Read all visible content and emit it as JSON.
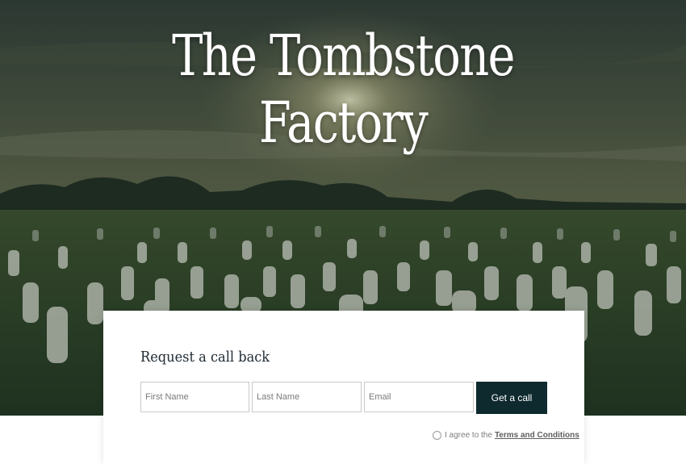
{
  "hero": {
    "title_line1": "The Tombstone",
    "title_line2": "Factory"
  },
  "callback": {
    "heading": "Request a call back",
    "first_name_placeholder": "First Name",
    "last_name_placeholder": "Last Name",
    "email_placeholder": "Email",
    "submit_label": "Get a call",
    "agree_text": "I agree to the",
    "terms_link": "Terms and Conditions"
  },
  "colors": {
    "button": "#0e2a2f",
    "heading": "#1f2a33"
  }
}
